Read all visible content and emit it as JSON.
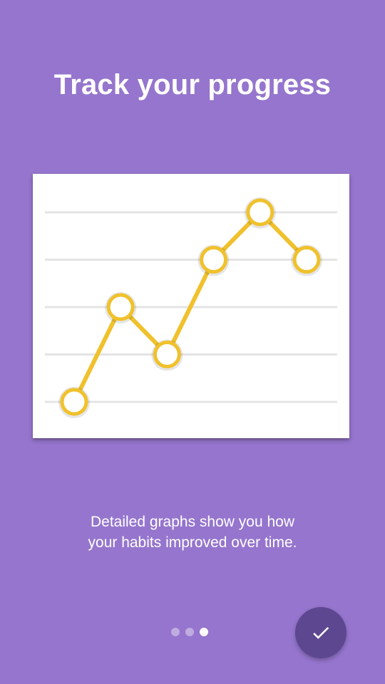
{
  "screen": {
    "title": "Track your progress",
    "description_lines": [
      "Detailed graphs show you how",
      "your habits improved over time."
    ]
  },
  "pager": {
    "count": 3,
    "active_index": 2
  },
  "done_button": {
    "icon": "check-icon"
  },
  "colors": {
    "background": "#9575cd",
    "accent": "#f0c12c",
    "fab": "#5d4791",
    "gridline": "#e4e4e4"
  },
  "chart_data": {
    "type": "line",
    "x": [
      1,
      2,
      3,
      4,
      5,
      6
    ],
    "series": [
      {
        "values": [
          1,
          3,
          2,
          4,
          5,
          4
        ]
      }
    ],
    "ylim": [
      1,
      5
    ],
    "grid": true,
    "title": "",
    "xlabel": "",
    "ylabel": ""
  }
}
